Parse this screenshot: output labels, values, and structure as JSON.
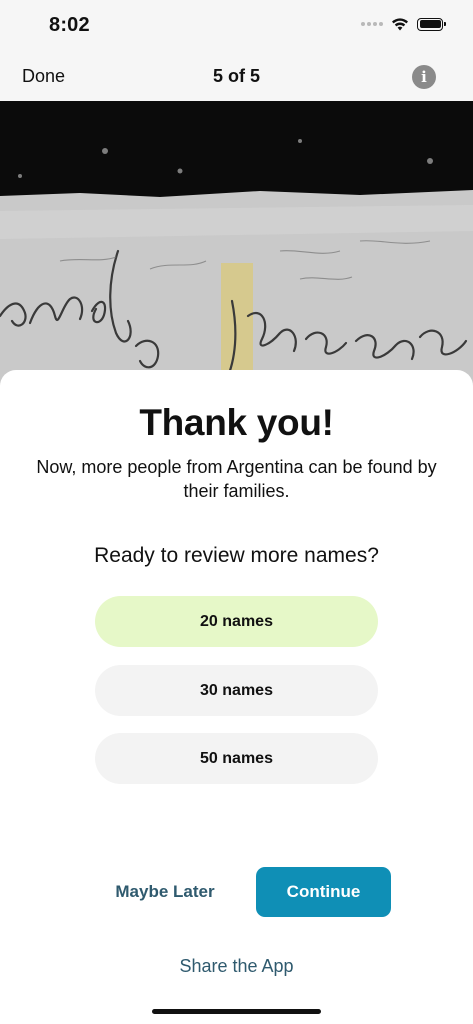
{
  "status_bar": {
    "time": "8:02",
    "icons": [
      "signal-icon",
      "wifi-icon",
      "battery-icon"
    ]
  },
  "nav": {
    "done_label": "Done",
    "title": "5 of 5",
    "info_icon": "info-icon"
  },
  "document_image": {
    "description_icon": "handwritten-record-image"
  },
  "sheet": {
    "title": "Thank you!",
    "message": "Now, more people from Argentina can be found by their families.",
    "question": "Ready to review more names?",
    "options": [
      {
        "label": "20 names",
        "selected": true
      },
      {
        "label": "30 names",
        "selected": false
      },
      {
        "label": "50 names",
        "selected": false
      }
    ],
    "maybe_later_label": "Maybe Later",
    "continue_label": "Continue",
    "share_label": "Share the App"
  },
  "colors": {
    "accent": "#0f8fb6",
    "selected_option": "#e6f8c8",
    "option_bg": "#f3f3f3",
    "link": "#2f5a6e"
  }
}
